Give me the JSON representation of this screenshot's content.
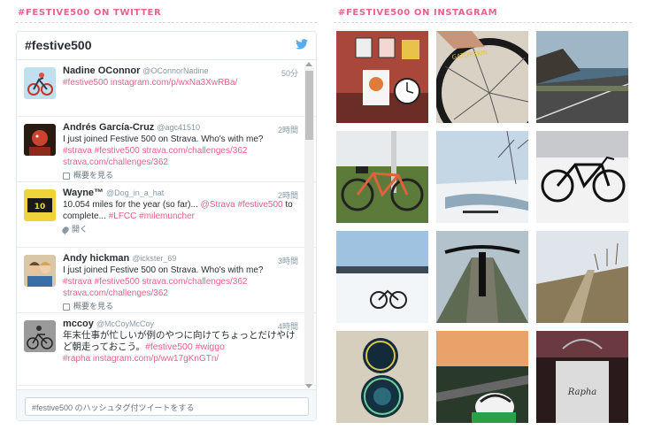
{
  "twitter_section": {
    "title": "#FESTIVE500 ON TWITTER",
    "widget_title": "#festive500",
    "compose_placeholder": "#festive500 のハッシュタグ付ツイートをする",
    "tweets": [
      {
        "name": "Nadine OConnor",
        "handle": "@OConnorNadine",
        "time": "50分",
        "text": "",
        "links": "#festive500 instagram.com/p/wxNa3XwRBa/",
        "meta": ""
      },
      {
        "name": "Andrés García-Cruz",
        "handle": "@agc41510",
        "time": "2時間",
        "text": "I just joined Festive 500 on Strava. Who's with me?",
        "links": "#strava #festive500 strava.com/challenges/362 strava.com/challenges/362",
        "meta": "概要を見る"
      },
      {
        "name": "Wayne™",
        "handle": "@Dog_in_a_hat",
        "time": "2時間",
        "text": "10.054 miles for the year (so far)...",
        "text_links": "@Strava #festive500",
        "text2": "to complete...",
        "links": "#LFCC #milemuncher",
        "meta": "開く"
      },
      {
        "name": "Andy hickman",
        "handle": "@ickster_69",
        "time": "3時間",
        "text": "I just joined Festive 500 on Strava. Who's with me?",
        "links": "#strava #festive500 strava.com/challenges/362 strava.com/challenges/362",
        "meta": "概要を見る"
      },
      {
        "name": "mccoy",
        "handle": "@McCoyMcCoy",
        "time": "4時間",
        "text": "年末仕事が忙しいが例のやつに向けてちょっとだけやけど朝走っておこう。",
        "text_links": "#festive500 #wiggo",
        "links": "#rapha instagram.com/p/ww17gKnGTn/",
        "meta": ""
      }
    ]
  },
  "instagram_section": {
    "title": "#FESTIVE500 ON INSTAGRAM",
    "photos": [
      "mugs-and-clock",
      "tire-and-wheel",
      "coastal-road",
      "orange-bike-grass",
      "snowy-river",
      "black-bike-snow",
      "snowy-field-bike",
      "handlebars-snow-road",
      "autumn-path",
      "festive500-badges",
      "cyclist-helmet-sunset",
      "rapha-tote-bag"
    ]
  },
  "colors": {
    "accent": "#e8628c",
    "twitter_blue": "#55acee",
    "text_dark": "#292f33",
    "text_muted": "#8899a6"
  }
}
